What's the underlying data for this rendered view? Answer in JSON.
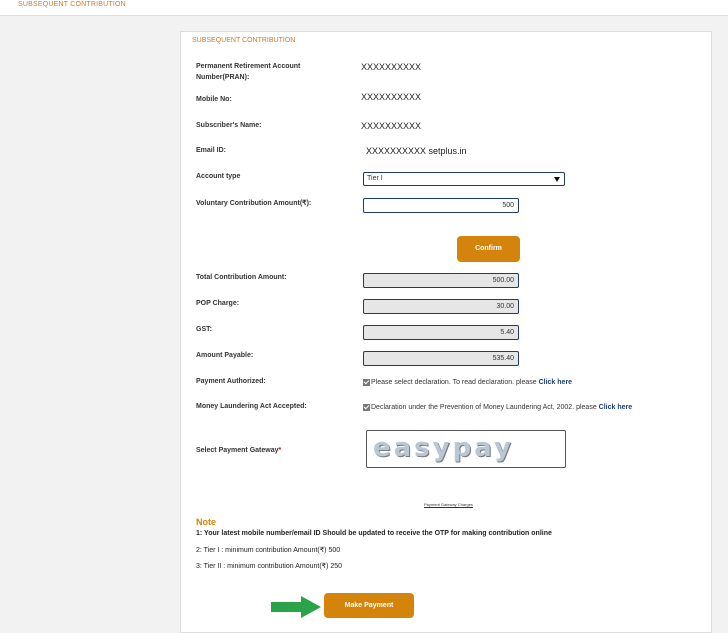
{
  "topbar": {
    "title": "SUBSEQUENT CONTRIBUTION"
  },
  "panel": {
    "title": "SUBSEQUENT CONTRIBUTION"
  },
  "fields": {
    "pran": {
      "label": "Permanent Retirement Account Number(PRAN):",
      "value": "XXXXXXXXXX"
    },
    "mobile": {
      "label": "Mobile No:",
      "value": "XXXXXXXXXX"
    },
    "name": {
      "label": "Subscriber's Name:",
      "value": "XXXXXXXXXX"
    },
    "email": {
      "label": "Email ID:",
      "value": "XXXXXXXXXX setplus.in"
    },
    "account_type": {
      "label": "Account type",
      "selected": "Tier I"
    },
    "voluntary": {
      "label": "Voluntary Contribution Amount(₹):",
      "value": "500"
    }
  },
  "confirm_label": "Confirm",
  "amounts": {
    "total": {
      "label": "Total Contribution Amount:",
      "value": "500.00"
    },
    "pop": {
      "label": "POP Charge:",
      "value": "30.00"
    },
    "gst": {
      "label": "GST:",
      "value": "5.40"
    },
    "payable": {
      "label": "Amount Payable:",
      "value": "535.40"
    }
  },
  "payment_authorized": {
    "label": "Payment Authorized:",
    "text": "Please select declaration. To read declaration. please ",
    "link": "Click here",
    "checked": true
  },
  "money_laundering": {
    "label": "Money Laundering Act Accepted:",
    "text": "Declaration under the Prevention of Money Laundering Act, 2002. please ",
    "link": "Click here",
    "checked": true
  },
  "gateway": {
    "label": "Select Payment Gateway",
    "required_mark": "*",
    "logo_text": "easypay",
    "charges_link": "Payment Gateway Charges"
  },
  "note": {
    "title": "Note",
    "items": [
      "1: Your latest mobile number/email ID Should be updated to receive the OTP for making contribution online",
      "2: Tier I : minimum contribution Amount(₹) 500",
      "3: Tier II : minimum contribution Amount(₹) 250"
    ]
  },
  "make_payment_label": "Make Payment",
  "colors": {
    "accent": "#d4840b",
    "link": "#1b3f7a",
    "arrow": "#2aa34a"
  }
}
